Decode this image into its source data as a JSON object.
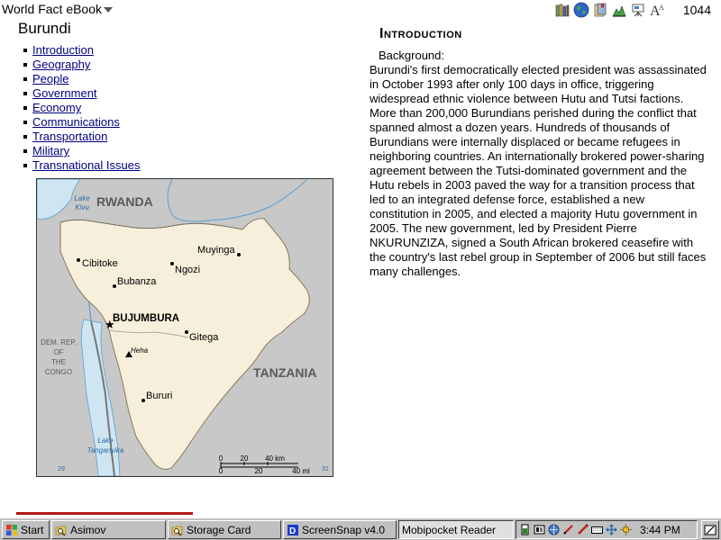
{
  "app": {
    "title": "World Fact eBook",
    "page_number": "1044"
  },
  "toolbar": {
    "buttons": [
      "library-icon",
      "globe-icon",
      "bookmarks-icon",
      "chart-icon",
      "presentation-icon",
      "font-size-icon"
    ]
  },
  "country": {
    "name": "Burundi"
  },
  "nav": {
    "items": [
      {
        "label": "Introduction"
      },
      {
        "label": "Geography"
      },
      {
        "label": "People"
      },
      {
        "label": "Government"
      },
      {
        "label": "Economy"
      },
      {
        "label": "Communications"
      },
      {
        "label": "Transportation"
      },
      {
        "label": "Military"
      },
      {
        "label": "Transnational Issues"
      }
    ]
  },
  "map": {
    "neighbors": {
      "north": "RWANDA",
      "east": "TANZANIA",
      "west_l1": "DEM. REP.",
      "west_l2": "OF",
      "west_l3": "THE",
      "west_l4": "CONGO"
    },
    "lakes": {
      "kivu_l1": "Lake",
      "kivu_l2": "Kivu",
      "tanganyika_l1": "Lake",
      "tanganyika_l2": "Tanganyika"
    },
    "capital": "BUJUMBURA",
    "cities": [
      "Muyinga",
      "Cibitoke",
      "Ngozi",
      "Bubanza",
      "Gitega",
      "Bururi"
    ],
    "peak": "Heha",
    "scale": {
      "km_0": "0",
      "km_20": "20",
      "km_40": "40 km",
      "mi_0": "0",
      "mi_20": "20",
      "mi_40": "40 mi"
    },
    "graticule": {
      "bottom_left": "29",
      "bottom_right": "31"
    }
  },
  "content": {
    "section_title": "Introduction",
    "background_label": "Background:",
    "body": "Burundi's first democratically elected president was assassinated in October 1993 after only 100 days in office, triggering widespread ethnic violence between Hutu and Tutsi factions. More than 200,000 Burundians perished during the conflict that spanned almost a dozen years. Hundreds of thousands of Burundians were internally displaced or became refugees in neighboring countries. An internationally brokered power-sharing agreement between the Tutsi-dominated government and the Hutu rebels in 2003 paved the way for a transition process that led to an integrated defense force, established a new constitution in 2005, and elected a majority Hutu government in 2005. The new government, led by President Pierre NKURUNZIZA, signed a South African brokered ceasefire with the country's last rebel group in September of 2006 but still faces many challenges."
  },
  "taskbar": {
    "start_label": "Start",
    "tasks": [
      {
        "label": "Asimov",
        "icon": "search-folder-icon"
      },
      {
        "label": "Storage Card",
        "icon": "search-folder-icon"
      },
      {
        "label": "ScreenSnap v4.0",
        "icon": "screensnap-icon"
      },
      {
        "label": "Mobipocket Reader",
        "icon": "",
        "active": true
      }
    ],
    "tray_icons": [
      "battery-icon",
      "memory-icon",
      "network-icon",
      "pen-icon",
      "stylus-icon",
      "keyboard-icon",
      "move-icon",
      "brightness-icon"
    ],
    "clock": "3:44 PM"
  },
  "colors": {
    "link": "#000080",
    "land_burundi": "#f7efdc",
    "land_neighbors": "#c8c8c8",
    "water": "#cfe6f2",
    "river": "#5a9fd4",
    "scroll_marker": "#b01818",
    "taskbar": "#c0c0c0"
  }
}
